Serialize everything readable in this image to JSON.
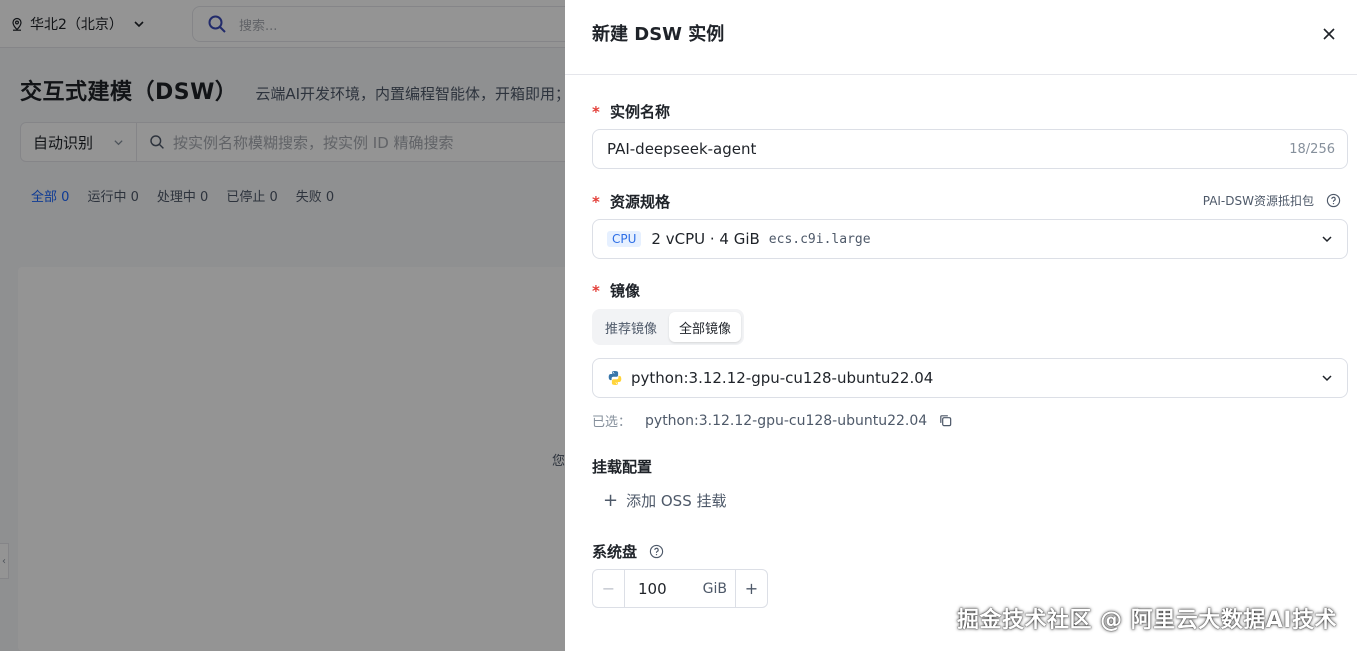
{
  "background": {
    "region": "华北2（北京）",
    "search_placeholder": "搜索...",
    "page_title": "交互式建模（DSW）",
    "page_subtitle": "云端AI开发环境，内置编程智能体，开箱即用；",
    "filter_select": "自动识别",
    "filter_placeholder": "按实例名称模糊搜索，按实例 ID 精确搜索",
    "status_tabs": [
      {
        "label": "全部",
        "count": "0"
      },
      {
        "label": "运行中",
        "count": "0"
      },
      {
        "label": "处理中",
        "count": "0"
      },
      {
        "label": "已停止",
        "count": "0"
      },
      {
        "label": "失败",
        "count": "0"
      }
    ],
    "empty_hint": "您"
  },
  "drawer": {
    "title": "新建 DSW 实例",
    "required_mark": "*",
    "instance_name": {
      "label": "实例名称",
      "value": "PAI-deepseek-agent",
      "counter": "18/256"
    },
    "resource_spec": {
      "label": "资源规格",
      "package_link": "PAI-DSW资源抵扣包",
      "tag": "CPU",
      "main": "2 vCPU · 4 GiB",
      "instance_type": "ecs.c9i.large"
    },
    "image": {
      "label": "镜像",
      "tabs": [
        "推荐镜像",
        "全部镜像"
      ],
      "active_tab": "全部镜像",
      "selected_value": "python:3.12.12-gpu-cu128-ubuntu22.04",
      "selected_label": "已选：",
      "selected_text": "python:3.12.12-gpu-cu128-ubuntu22.04"
    },
    "mount": {
      "label": "挂载配置",
      "add_button": "添加 OSS 挂载"
    },
    "system_disk": {
      "label": "系统盘",
      "value": "100",
      "unit": "GiB"
    }
  },
  "watermark": "掘金技术社区 @ 阿里云大数据AI技术"
}
